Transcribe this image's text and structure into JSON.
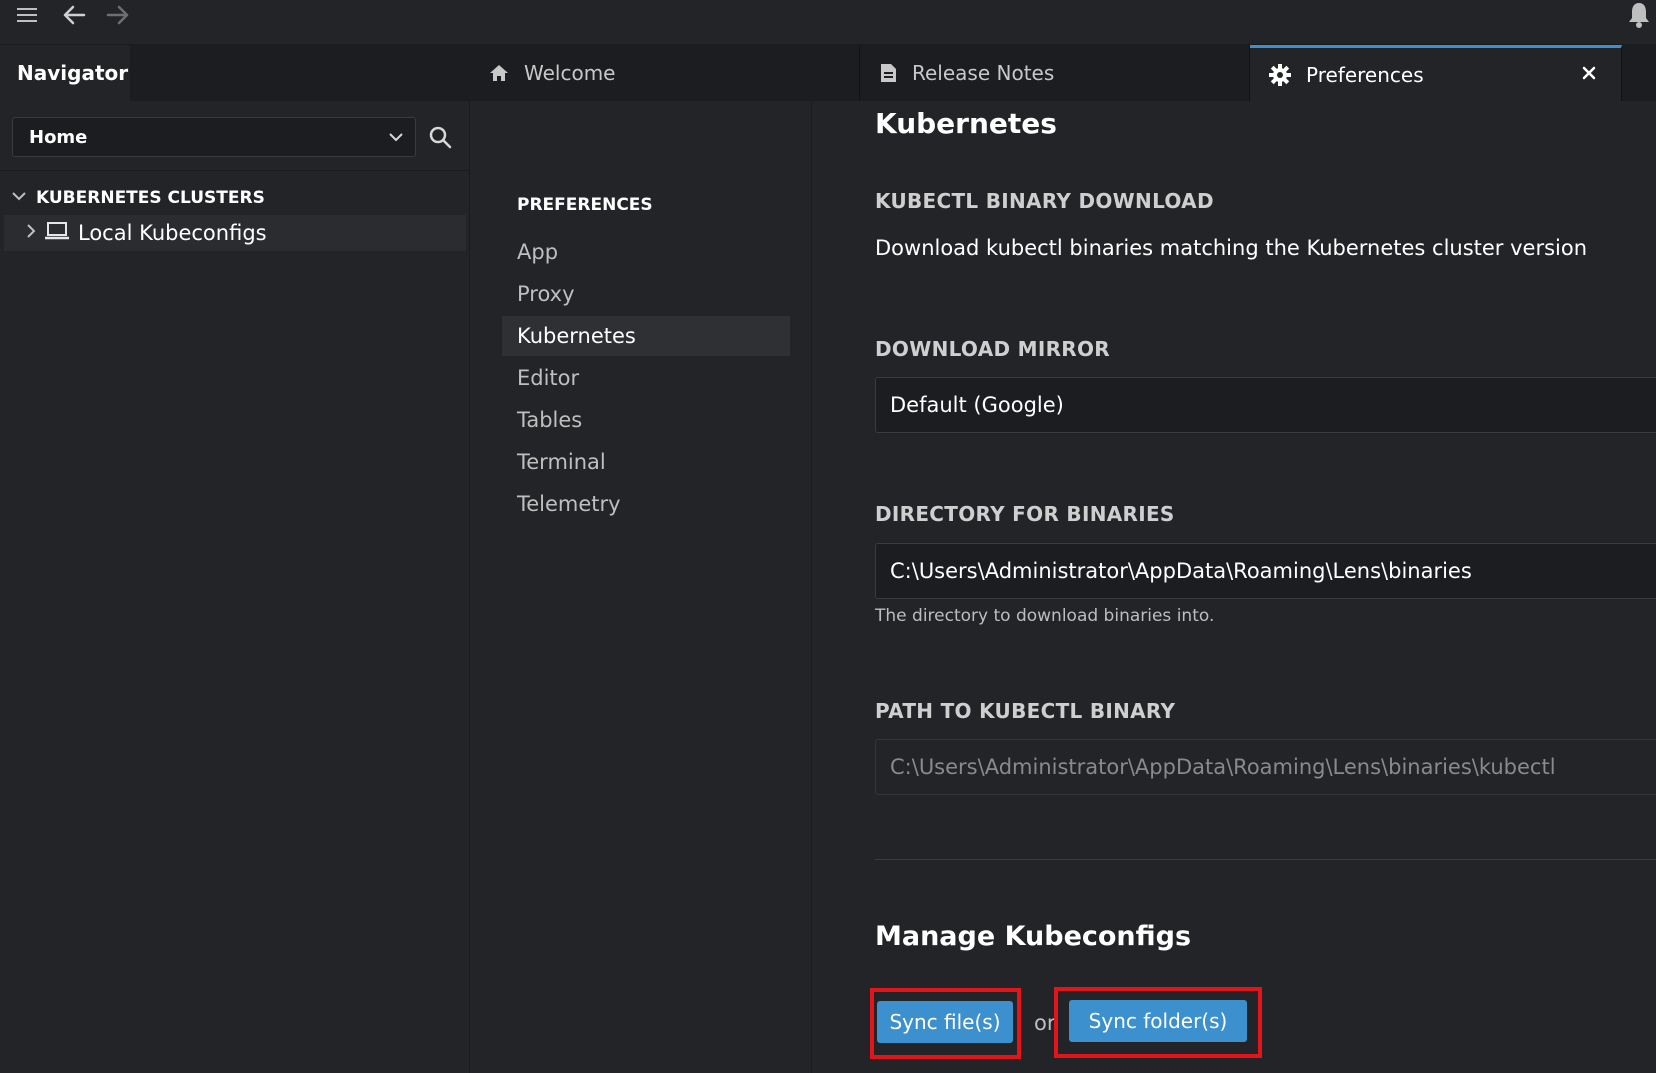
{
  "navigator": {
    "tab_label": "Navigator",
    "context_select": {
      "value": "Home"
    },
    "tree": {
      "header": "KUBERNETES CLUSTERS",
      "items": [
        {
          "label": "Local Kubeconfigs"
        }
      ]
    }
  },
  "tabs": [
    {
      "label": "Welcome",
      "icon": "home-icon"
    },
    {
      "label": "Release Notes",
      "icon": "document-icon"
    },
    {
      "label": "Preferences",
      "icon": "gear-icon",
      "active": true
    }
  ],
  "preferences": {
    "heading": "PREFERENCES",
    "items": [
      {
        "label": "App"
      },
      {
        "label": "Proxy"
      },
      {
        "label": "Kubernetes",
        "active": true
      },
      {
        "label": "Editor"
      },
      {
        "label": "Tables"
      },
      {
        "label": "Terminal"
      },
      {
        "label": "Telemetry"
      }
    ]
  },
  "content": {
    "title": "Kubernetes",
    "kubectl_download": {
      "label": "KUBECTL BINARY DOWNLOAD",
      "description": "Download kubectl binaries matching the Kubernetes cluster version"
    },
    "download_mirror": {
      "label": "DOWNLOAD MIRROR",
      "value": "Default (Google)"
    },
    "directory": {
      "label": "DIRECTORY FOR BINARIES",
      "value": "C:\\Users\\Administrator\\AppData\\Roaming\\Lens\\binaries",
      "hint": "The directory to download binaries into."
    },
    "kubectl_path": {
      "label": "PATH TO KUBECTL BINARY",
      "placeholder": "C:\\Users\\Administrator\\AppData\\Roaming\\Lens\\binaries\\kubectl"
    },
    "manage": {
      "title": "Manage Kubeconfigs",
      "sync_files": "Sync file(s)",
      "or": "or",
      "sync_folders": "Sync folder(s)"
    }
  },
  "colors": {
    "accent": "#3d90ce",
    "highlight": "#e3151b",
    "background": "#232427"
  }
}
